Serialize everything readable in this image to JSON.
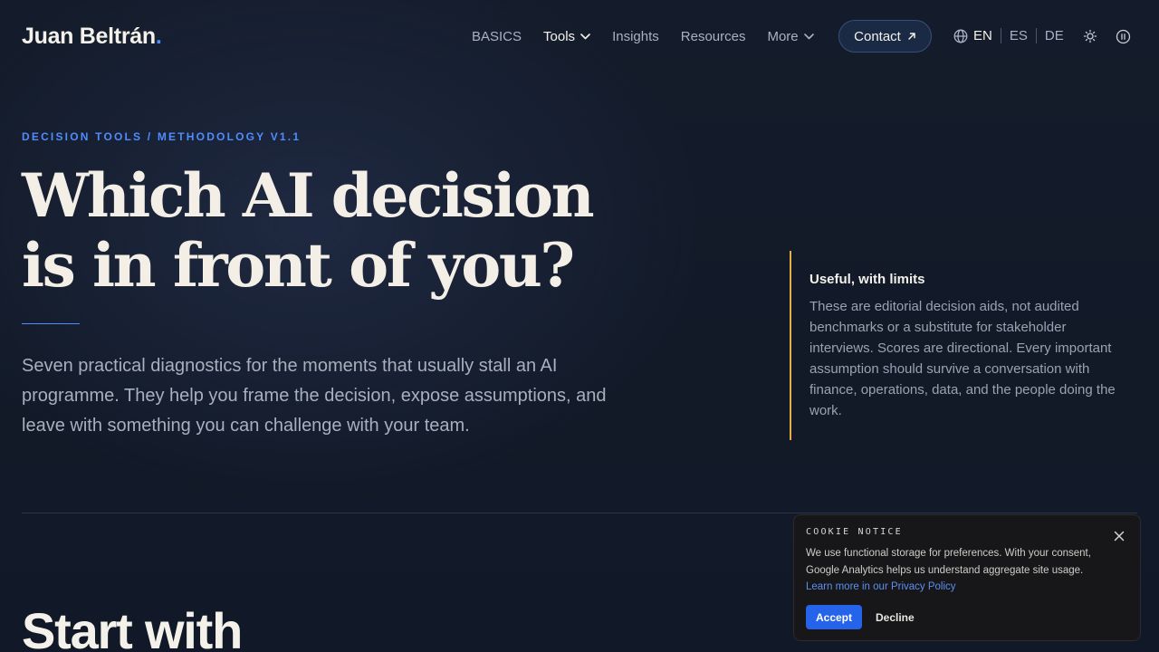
{
  "header": {
    "logo_text": "Juan Beltrán",
    "logo_dot": ".",
    "nav": [
      {
        "label": "BASICS",
        "has_dropdown": false
      },
      {
        "label": "Tools",
        "has_dropdown": true,
        "active": true
      },
      {
        "label": "Insights",
        "has_dropdown": false
      },
      {
        "label": "Resources",
        "has_dropdown": false
      },
      {
        "label": "More",
        "has_dropdown": true
      }
    ],
    "contact_label": "Contact",
    "languages": [
      "EN",
      "ES",
      "DE"
    ],
    "current_language": "EN",
    "icons": [
      "globe-icon",
      "sun-icon",
      "pause-icon"
    ]
  },
  "hero": {
    "eyebrow": "DECISION TOOLS / METHODOLOGY V1.1",
    "title_line1": "Which AI decision",
    "title_line2": "is in front of you?",
    "lede": "Seven practical diagnostics for the moments that usually stall an AI programme. They help you frame the decision, expose assumptions, and leave with something you can challenge with your team."
  },
  "note": {
    "title": "Useful, with limits",
    "body": "These are editorial decision aids, not audited benchmarks or a substitute for stakeholder interviews. Scores are directional. Every important assumption should survive a conversation with finance, operations, data, and the people doing the work."
  },
  "section": {
    "title": "Start with"
  },
  "cookie": {
    "title": "COOKIE NOTICE",
    "text": "We use functional storage for preferences. With your consent, Google Analytics helps us understand aggregate site usage. ",
    "link_text": "Learn more in our Privacy Policy",
    "accept_label": "Accept",
    "decline_label": "Decline"
  },
  "colors": {
    "accent": "#4f8cff",
    "note_border": "#e6ae43",
    "accept_button": "#2563eb",
    "background": "#141c2b"
  }
}
